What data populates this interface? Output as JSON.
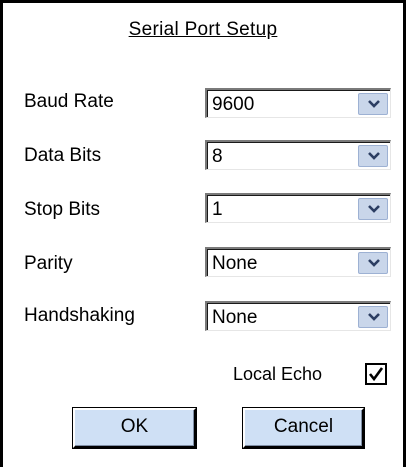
{
  "dialog": {
    "title": "Serial Port Setup"
  },
  "fields": [
    {
      "label": "Baud Rate",
      "value": "9600"
    },
    {
      "label": "Data Bits",
      "value": "8"
    },
    {
      "label": "Stop Bits",
      "value": "1"
    },
    {
      "label": "Parity",
      "value": "None"
    },
    {
      "label": "Handshaking",
      "value": "None"
    }
  ],
  "local_echo": {
    "label": "Local Echo",
    "checked": true
  },
  "buttons": {
    "ok": "OK",
    "cancel": "Cancel"
  },
  "icons": {
    "dropdown": "chevron-down-icon",
    "check": "checkmark-icon"
  },
  "colors": {
    "dropdown_button": "#c9d6ea",
    "push_button": "#cfe0f5"
  }
}
